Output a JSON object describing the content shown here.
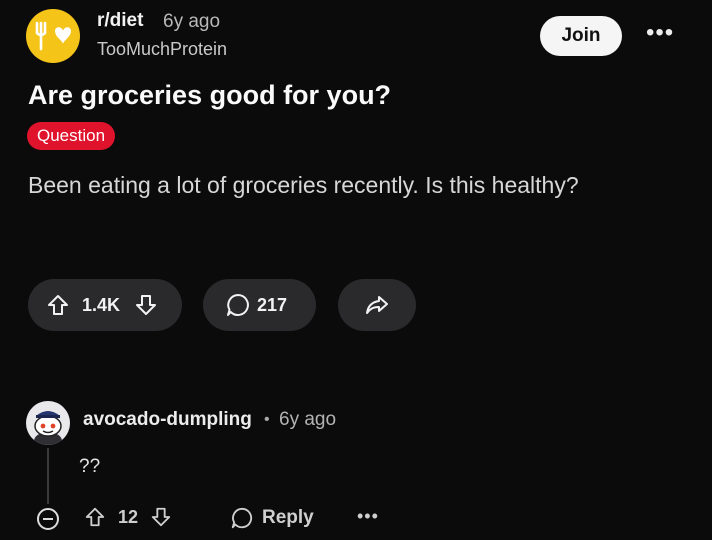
{
  "post": {
    "subreddit": "r/diet",
    "time": "6y ago",
    "author": "TooMuchProtein",
    "join_label": "Join",
    "more_label": "•••",
    "title": "Are groceries good for you?",
    "flair": "Question",
    "body": "Been eating a lot of groceries recently. Is this healthy?",
    "votes": "1.4K",
    "comments": "217"
  },
  "comment": {
    "author": "avocado-dumpling",
    "separator": "•",
    "time": "6y ago",
    "text": "??",
    "votes": "12",
    "reply_label": "Reply",
    "more_label": "•••"
  },
  "colors": {
    "background": "#0b0b0c",
    "subreddit_icon": "#f4c419",
    "flair_bg": "#e0132c",
    "pill_bg": "#2a2a2c"
  }
}
